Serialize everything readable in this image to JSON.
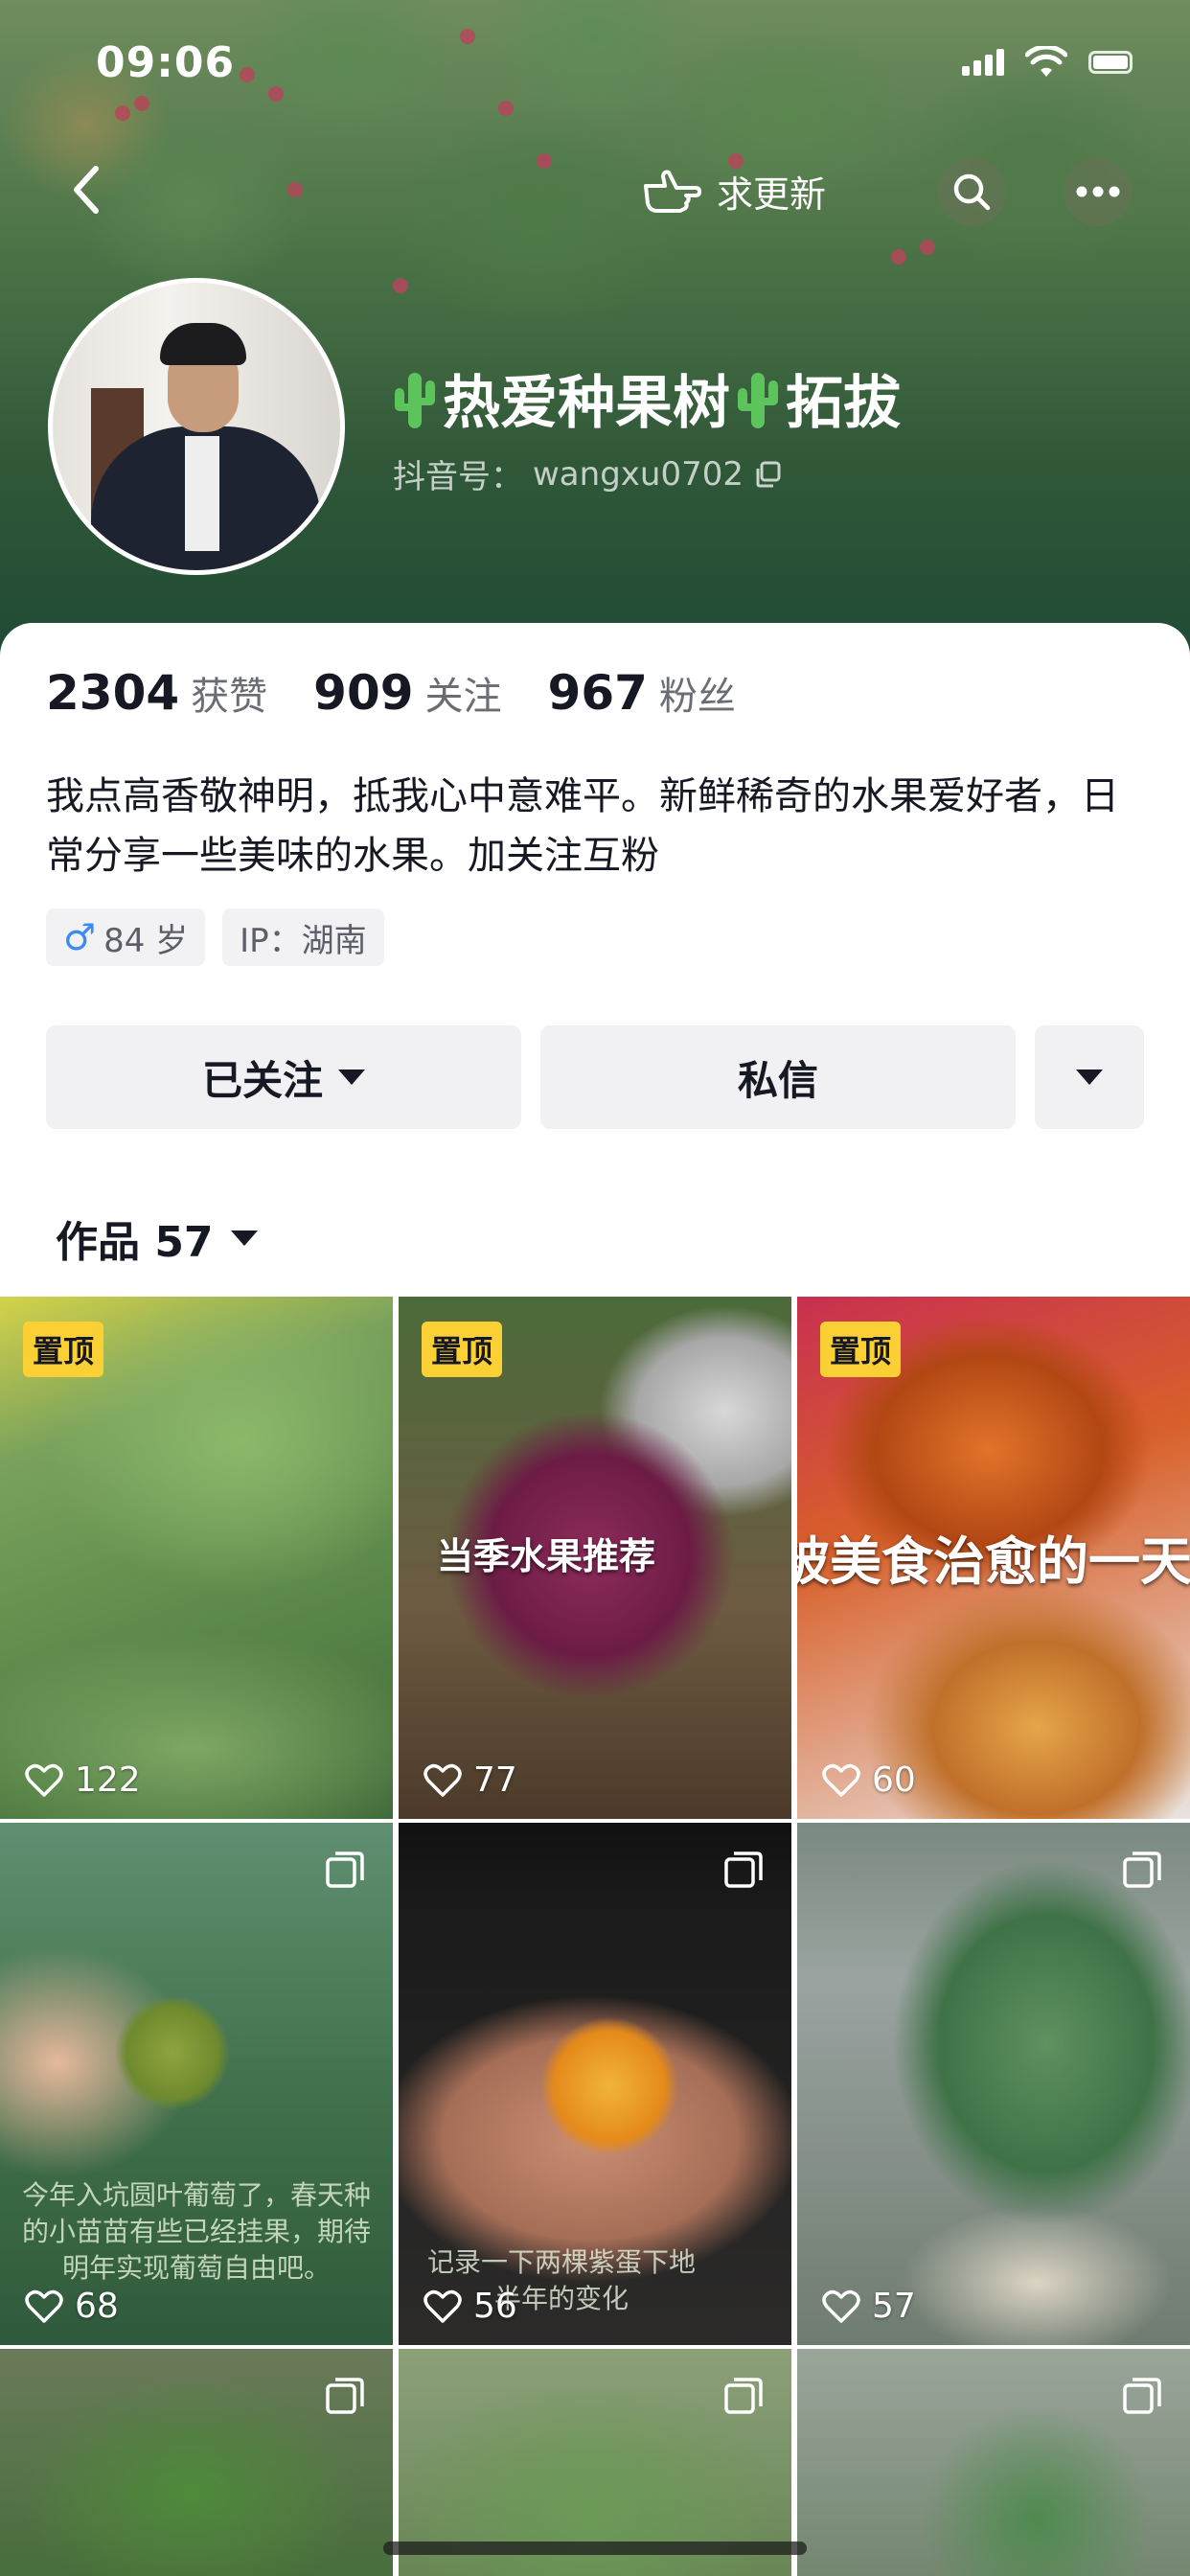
{
  "status_bar": {
    "time": "09:06"
  },
  "nav": {
    "request_update_label": "求更新"
  },
  "profile": {
    "nickname_part1": "热爱种果树",
    "nickname_part2": "拓拔",
    "nickname_emoji": "cactus-emoji",
    "douyin_id_label": "抖音号：",
    "douyin_id": "wangxu0702",
    "stats": {
      "likes_value": "2304",
      "likes_label": "获赞",
      "following_value": "909",
      "following_label": "关注",
      "followers_value": "967",
      "followers_label": "粉丝"
    },
    "bio": "我点高香敬神明，抵我心中意难平。新鲜稀奇的水果爱好者，日常分享一些美味的水果。加关注互粉",
    "tags": {
      "gender_symbol": "♂",
      "age": "84 岁",
      "ip": "IP：湖南"
    }
  },
  "actions": {
    "follow_label": "已关注",
    "message_label": "私信"
  },
  "works_tab": {
    "label": "作品 57"
  },
  "grid": {
    "pinned_label": "置顶",
    "items": [
      {
        "likes": "122",
        "overlay": "",
        "caption": ""
      },
      {
        "likes": "77",
        "overlay": "当季水果推荐",
        "caption": ""
      },
      {
        "likes": "60",
        "overlay": "被美食治愈的一天",
        "caption": ""
      },
      {
        "likes": "68",
        "overlay": "",
        "caption": "今年入坑圆叶葡萄了，春天种的小苗苗有些已经挂果，期待明年实现葡萄自由吧。"
      },
      {
        "likes": "56",
        "overlay": "",
        "caption": "记录一下两棵紫蛋下地半年的变化"
      },
      {
        "likes": "57",
        "overlay": "",
        "caption": ""
      },
      {
        "likes": "",
        "overlay": "",
        "caption": ""
      },
      {
        "likes": "",
        "overlay": "",
        "caption": ""
      },
      {
        "likes": "",
        "overlay": "",
        "caption": ""
      }
    ]
  },
  "icons": {
    "back": "chevron-left-icon",
    "hand": "hand-pointer-icon",
    "search": "search-icon",
    "more": "more-horizontal-icon",
    "copy": "copy-icon",
    "heart": "heart-outline-icon",
    "multi": "multi-image-icon",
    "dropdown": "triangle-down-icon"
  },
  "colors": {
    "pin_badge": "#fbd034",
    "male": "#3c8bf5",
    "button_bg": "#f1f1f3"
  }
}
